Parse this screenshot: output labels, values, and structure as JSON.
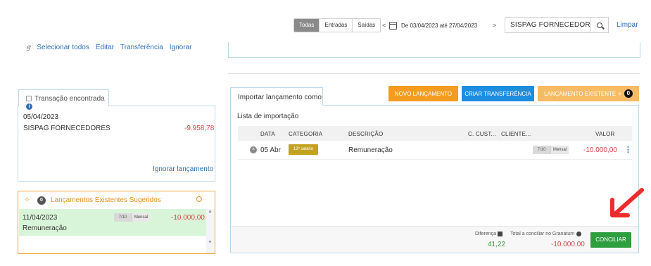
{
  "filters": {
    "tabs": [
      {
        "label": "Todas",
        "active": true
      },
      {
        "label": "Entradas",
        "active": false
      },
      {
        "label": "Saídas",
        "active": false
      }
    ],
    "prev": "<",
    "next": ">",
    "date_range": "De 03/04/2023 até 27/04/2023",
    "search_value": "SISPAG FORNECEDORES",
    "clear_label": "Limpar"
  },
  "actions": {
    "icon_glyph": "ꞡ",
    "select_all": "Selecionar todos",
    "edit": "Editar",
    "transfer": "Transferência",
    "ignore": "Ignorar"
  },
  "found": {
    "tab_label": "Transação encontrada",
    "date": "05/04/2023",
    "name": "SISPAG FORNECEDORES",
    "amount": "-9.958,78",
    "ignore_link": "Ignorar lançamento"
  },
  "suggested": {
    "count": "0",
    "title": "Lançamentos Existentes Sugeridos",
    "item": {
      "date": "11/04/2023",
      "installment": "7/10",
      "frequency": "Mensal",
      "amount": "-10.000,00",
      "description": "Remuneração"
    }
  },
  "import": {
    "tab_label": "Importar lançamento como",
    "btn_new": "NOVO LANÇAMENTO",
    "btn_transfer": "CRIAR TRANSFERÊNCIA",
    "btn_existing": "LANÇAMENTO EXISTENTE",
    "existing_count": "0",
    "list_title": "Lista de importação",
    "columns": [
      "DATA",
      "CATEGORIA",
      "DESCRIÇÃO",
      "C. CUST...",
      "CLIENTE...",
      "VALOR"
    ],
    "row": {
      "date": "05 Abr",
      "category": "13º salário",
      "description": "Remuneração",
      "installment": "7/10",
      "frequency": "Mensal",
      "amount": "-10.000,00"
    },
    "footer": {
      "difference_label": "Diferença",
      "difference_value": "41,22",
      "total_label": "Total a conciliar no Granatum",
      "total_value": "-10.000,00",
      "reconcile_label": "CONCILIAR"
    }
  },
  "colors": {
    "accent_blue": "#2d6fb8",
    "orange": "#f39c1f",
    "orange_light": "#f7bb63",
    "blue_button": "#1d8de0",
    "green_button": "#2e9e3f",
    "pointer_arrow": "#ee2b2b"
  }
}
